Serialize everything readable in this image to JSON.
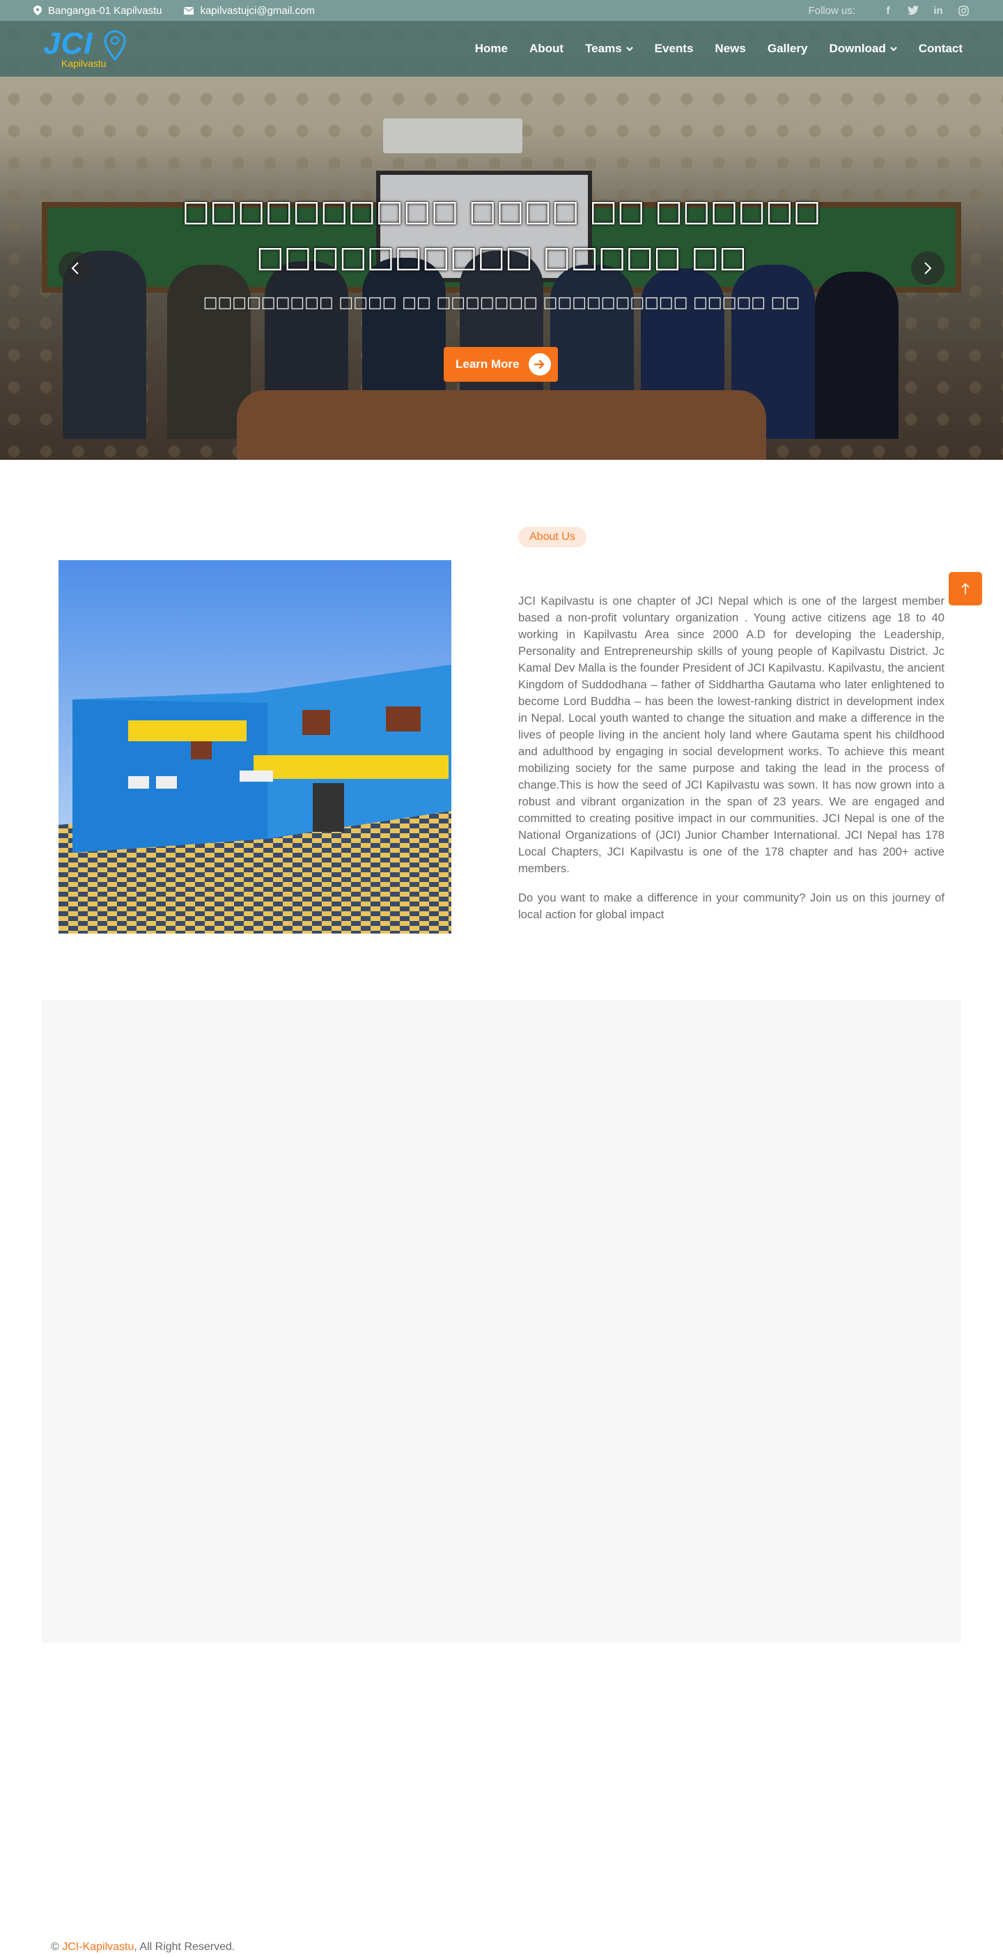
{
  "topbar": {
    "address": "Banganga-01 Kapilvastu",
    "email": "kapilvastujci@gmail.com",
    "follow_label": "Follow us:",
    "social": [
      {
        "icon": "facebook-icon",
        "glyph": "f"
      },
      {
        "icon": "twitter-icon",
        "glyph": "t"
      },
      {
        "icon": "linkedin-icon",
        "glyph": "in"
      },
      {
        "icon": "instagram-icon",
        "glyph": "◎"
      }
    ]
  },
  "logo": {
    "text": "JCI",
    "subtitle": "Kapilvastu"
  },
  "nav": {
    "home": "Home",
    "about": "About",
    "teams": "Teams",
    "events": "Events",
    "news": "News",
    "gallery": "Gallery",
    "download": "Download",
    "contact": "Contact"
  },
  "hero": {
    "title_line1": "□□□□□□□□□□ □□□□ □□ □□□□□□",
    "title_line2": "□□□□□□□□□□ □□□□□ □□",
    "subtitle": "□□□□□□□□□ □□□□ □□ □□□□□□□ □□□□□□□□□□ □□□□□ □□",
    "button_label": "Learn More"
  },
  "about": {
    "badge": "About Us",
    "paragraph1": "JCI Kapilvastu is one chapter of JCI Nepal which is one of the largest member based a non-profit voluntary organization . Young active citizens age 18 to 40 working in Kapilvastu Area since 2000 A.D for developing the Leadership, Personality and Entrepreneurship skills of young people of Kapilvastu District. Jc Kamal Dev Malla is the founder President of JCI Kapilvastu. Kapilvastu, the ancient Kingdom of Suddodhana – father of Siddhartha Gautama who later enlightened to become Lord Buddha – has been the lowest-ranking district in development index in Nepal. Local youth wanted to change the situation and make a difference in the lives of people living in the ancient holy land where Gautama spent his childhood and adulthood by engaging in social development works. To achieve this meant mobilizing society for the same purpose and taking the lead in the process of change.This is how the seed of JCI Kapilvastu was sown. It has now grown into a robust and vibrant organization in the span of 23 years. We are engaged and committed to creating positive impact in our communities. JCI Nepal is one of the National Organizations of (JCI) Junior Chamber International. JCI Nepal has 178 Local Chapters, JCI Kapilvastu is one of the 178 chapter and has 200+ active members.",
    "paragraph2": "Do you want to make a difference in your community? Join us on this journey of local action for global impact"
  },
  "footer": {
    "copyright_symbol": "©",
    "brand": "JCI-Kapilvastu",
    "rest": ", All Right Reserved."
  },
  "colors": {
    "accent": "#f7731b",
    "topbar": "#7a9c98",
    "navbar": "#4a6d69",
    "logo_blue": "#2ea3f2",
    "logo_yellow": "#f5c518"
  }
}
